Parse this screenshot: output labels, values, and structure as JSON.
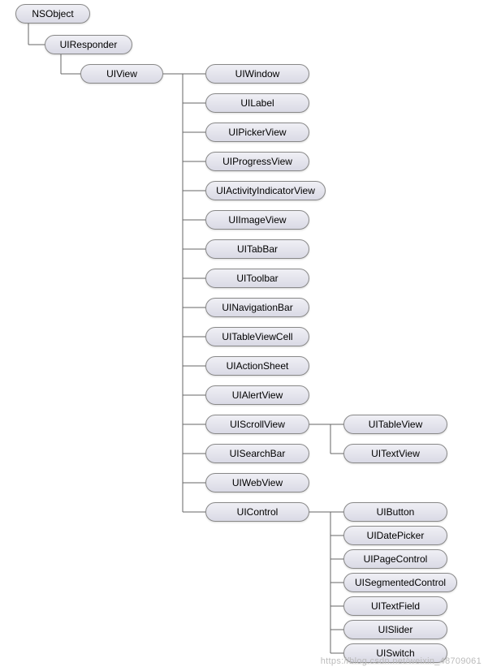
{
  "tree": {
    "root": "NSObject",
    "responder": "UIResponder",
    "uiview": "UIView",
    "uiview_children": [
      "UIWindow",
      "UILabel",
      "UIPickerView",
      "UIProgressView",
      "UIActivityIndicatorView",
      "UIImageView",
      "UITabBar",
      "UIToolbar",
      "UINavigationBar",
      "UITableViewCell",
      "UIActionSheet",
      "UIAlertView",
      "UIScrollView",
      "UISearchBar",
      "UIWebView",
      "UIControl"
    ],
    "scrollview_children": [
      "UITableView",
      "UITextView"
    ],
    "uicontrol_children": [
      "UIButton",
      "UIDatePicker",
      "UIPageControl",
      "UISegmentedControl",
      "UITextField",
      "UISlider",
      "UISwitch"
    ]
  },
  "watermark": "https://blog.csdn.net/weixin_48709061"
}
